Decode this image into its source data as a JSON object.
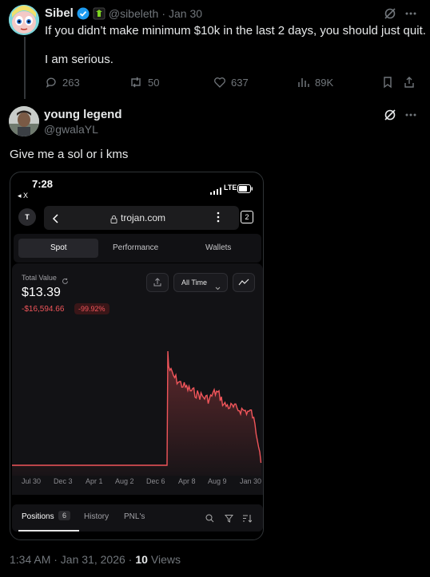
{
  "tweet1": {
    "name": "Sibel",
    "handle": "@sibeleth",
    "dot": "·",
    "date": "Jan 30",
    "line1": "If you didn’t make minimum $10k in the last 2 days, you should just quit.",
    "line2": "I am serious.",
    "replies": "263",
    "reposts": "50",
    "likes": "637",
    "views": "89K"
  },
  "tweet2": {
    "name": "young legend",
    "handle": "@gwalaYL",
    "text": "Give me a sol or i kms",
    "timestamp": "1:34 AM · Jan 31, 2026 ·",
    "views_count": "10",
    "views_label": "Views"
  },
  "phone": {
    "time": "7:28",
    "back_label": "◂ X",
    "network": "LTE",
    "url": "trojan.com",
    "tab_count": "2",
    "tabs": [
      "Spot",
      "Performance",
      "Wallets"
    ],
    "total_value_label": "Total Value",
    "total_value": "$13.39",
    "change": "-$16,594.66",
    "change_pct": "-99.92%",
    "range": "All Time",
    "x_labels": [
      "Jul 30",
      "Dec 3",
      "Apr 1",
      "Aug 2",
      "Dec 6",
      "Apr 8",
      "Aug 9",
      "Jan 30"
    ],
    "bottom_tabs": {
      "positions": "Positions",
      "positions_count": "6",
      "history": "History",
      "pnl": "PNL's"
    }
  },
  "colors": {
    "accent_blue": "#1d9bf0",
    "chart_red": "#f0555a",
    "muted": "#71767b"
  },
  "chart_data": {
    "type": "line",
    "x": [
      "Jul 30",
      "Dec 3",
      "Apr 1",
      "Aug 2",
      "Dec 6",
      "Apr 8",
      "Aug 9",
      "Jan 30"
    ],
    "series": [
      {
        "values": [
          0,
          0,
          0,
          0,
          0,
          16000,
          9000,
          13
        ]
      }
    ]
  }
}
